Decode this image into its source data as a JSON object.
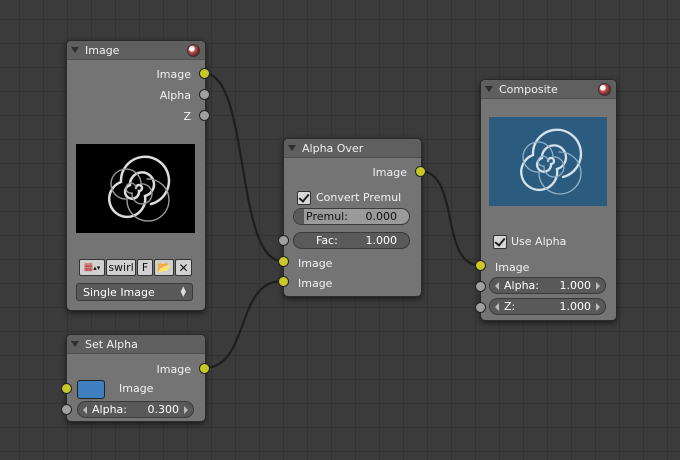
{
  "nodes": {
    "image": {
      "title": "Image",
      "outputs": [
        "Image",
        "Alpha",
        "Z"
      ],
      "image_name": "swirl",
      "fake_user_label": "F",
      "source_option": "Single Image"
    },
    "set_alpha": {
      "title": "Set Alpha",
      "output": "Image",
      "input_image": "Image",
      "color": "#3f7fbf",
      "alpha_label": "Alpha:",
      "alpha_value": "0.300"
    },
    "alpha_over": {
      "title": "Alpha Over",
      "output": "Image",
      "convert_premul_label": "Convert Premul",
      "convert_premul_checked": true,
      "premul_label": "Premul:",
      "premul_value": "0.000",
      "fac_label": "Fac:",
      "fac_value": "1.000",
      "input_1": "Image",
      "input_2": "Image"
    },
    "composite": {
      "title": "Composite",
      "use_alpha_label": "Use Alpha",
      "use_alpha_checked": true,
      "input_image": "Image",
      "alpha_label": "Alpha:",
      "alpha_value": "1.000",
      "z_label": "Z:",
      "z_value": "1.000"
    }
  },
  "colors": {
    "image_socket": "#c8c828",
    "value_socket": "#a0a0a0",
    "preview_bg": "#2b5c80"
  }
}
